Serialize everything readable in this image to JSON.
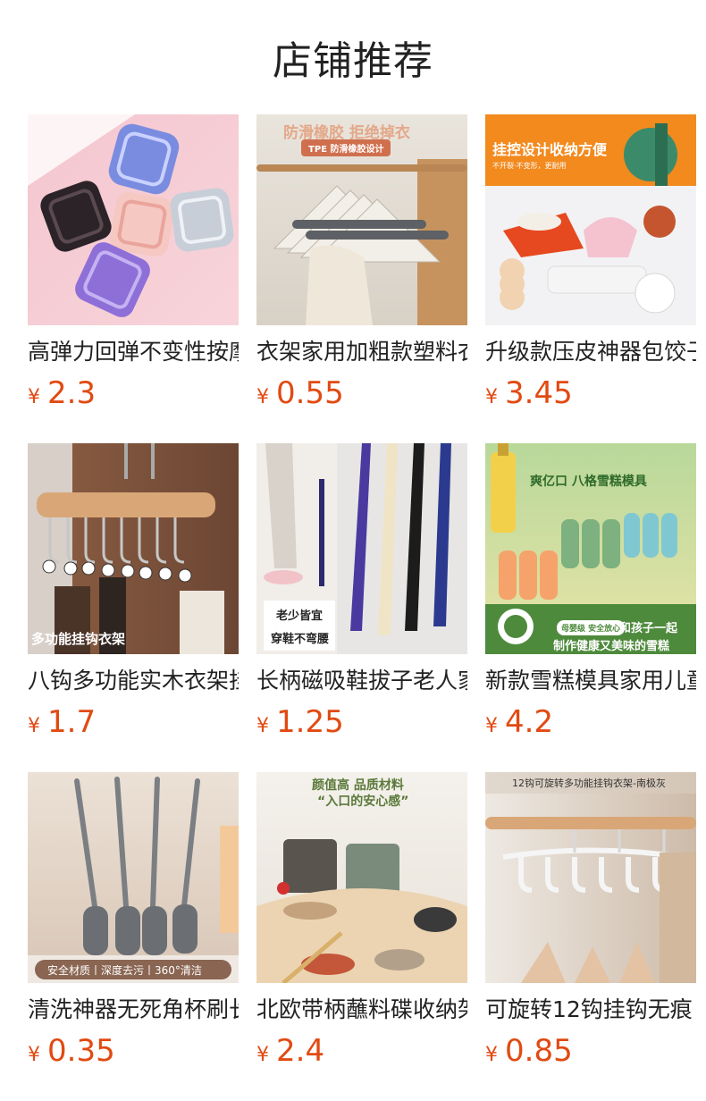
{
  "header": {
    "title": "店铺推荐"
  },
  "currency_symbol": "¥",
  "products": [
    {
      "name": "高弹力回弹不变性按摩",
      "price": "2.3",
      "image_texts": []
    },
    {
      "name": "衣架家用加粗款塑料衣",
      "price": "0.55",
      "image_texts": [
        "防滑橡胶 拒绝掉衣",
        "TPE 防滑橡胶设计"
      ]
    },
    {
      "name": "升级款压皮神器包饺子",
      "price": "3.45",
      "image_texts": [
        "挂控设计收纳方便",
        "不开裂·不变形，更耐用"
      ]
    },
    {
      "name": "八钩多功能实木衣架挂",
      "price": "1.7",
      "image_texts": [
        "多功能挂钩衣架"
      ]
    },
    {
      "name": "长柄磁吸鞋拔子老人家",
      "price": "1.25",
      "image_texts": [
        "老少皆宜",
        "穿鞋不弯腰"
      ]
    },
    {
      "name": "新款雪糕模具家用儿童",
      "price": "4.2",
      "image_texts": [
        "爽亿口 八格雪糕模具",
        "母婴级 安全放心",
        "和孩子一起",
        "制作健康又美味的雪糕"
      ]
    },
    {
      "name": "清洗神器无死角杯刷长",
      "price": "0.35",
      "image_texts": [
        "安全材质丨深度去污丨360°清洁"
      ]
    },
    {
      "name": "北欧带柄蘸料碟收纳架",
      "price": "2.4",
      "image_texts": [
        "颜值高 品质材料",
        "“入口的安心感”"
      ]
    },
    {
      "name": "可旋转12钩挂钩无痕",
      "price": "0.85",
      "image_texts": [
        "12钩可旋转多功能挂钩衣架-南极灰"
      ]
    }
  ]
}
